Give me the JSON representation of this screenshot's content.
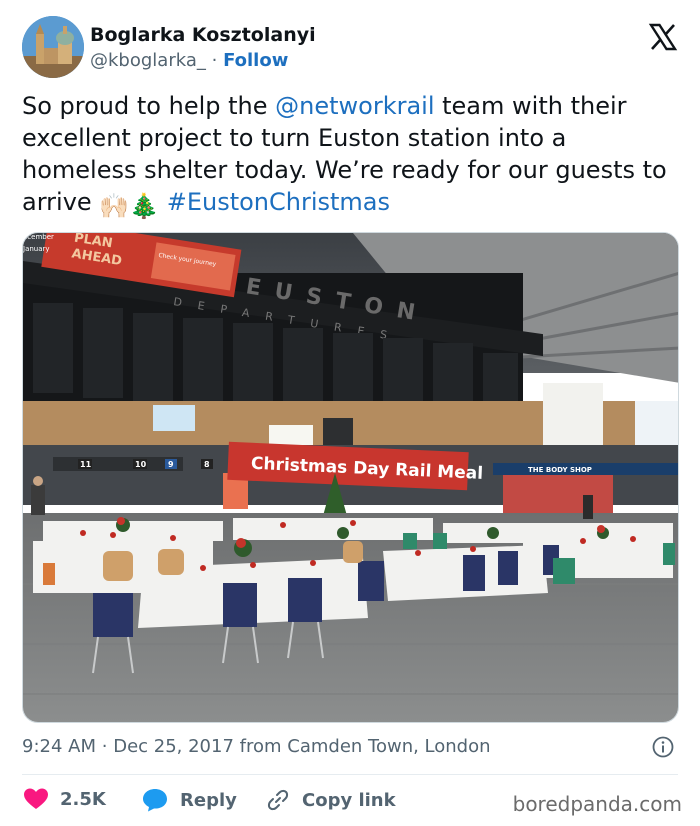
{
  "author": {
    "name": "Boglarka Kosztolanyi",
    "handle": "@kboglarka_",
    "separator": "·",
    "follow_label": "Follow"
  },
  "tweet": {
    "text_part1": "So proud to help the ",
    "mention": "@networkrail",
    "text_part2": " team with their excellent project to turn Euston station into a homeless shelter today. We’re ready for our guests to arrive ",
    "emoji_hands": "🙌🏻",
    "emoji_tree": "🎄",
    "hashtag": "#EustonChristmas"
  },
  "photo": {
    "banner_text": "Christmas Day Rail Meal",
    "station_sign": "EUSTON",
    "departures_sign": "DEPARTURES",
    "ad_text_1": "PLAN",
    "ad_text_2": "AHEAD",
    "ad_line_1": "ecember",
    "ad_line_2": "January",
    "ad_small": "Check your journey",
    "shop_sign": "THE BODY SHOP",
    "platform_numbers": [
      "11",
      "10",
      "9",
      "8"
    ]
  },
  "meta": {
    "time": "9:24 AM",
    "separator": "·",
    "date": "Dec 25, 2017",
    "location": "from Camden Town, London"
  },
  "actions": {
    "likes": "2.5K",
    "reply_label": "Reply",
    "copy_link_label": "Copy link"
  },
  "watermark": "boredpanda.com",
  "colors": {
    "link": "#1d6fbf",
    "heart": "#f91880",
    "reply_bubble": "#1d9bf0",
    "banner_red": "#c8362e"
  }
}
